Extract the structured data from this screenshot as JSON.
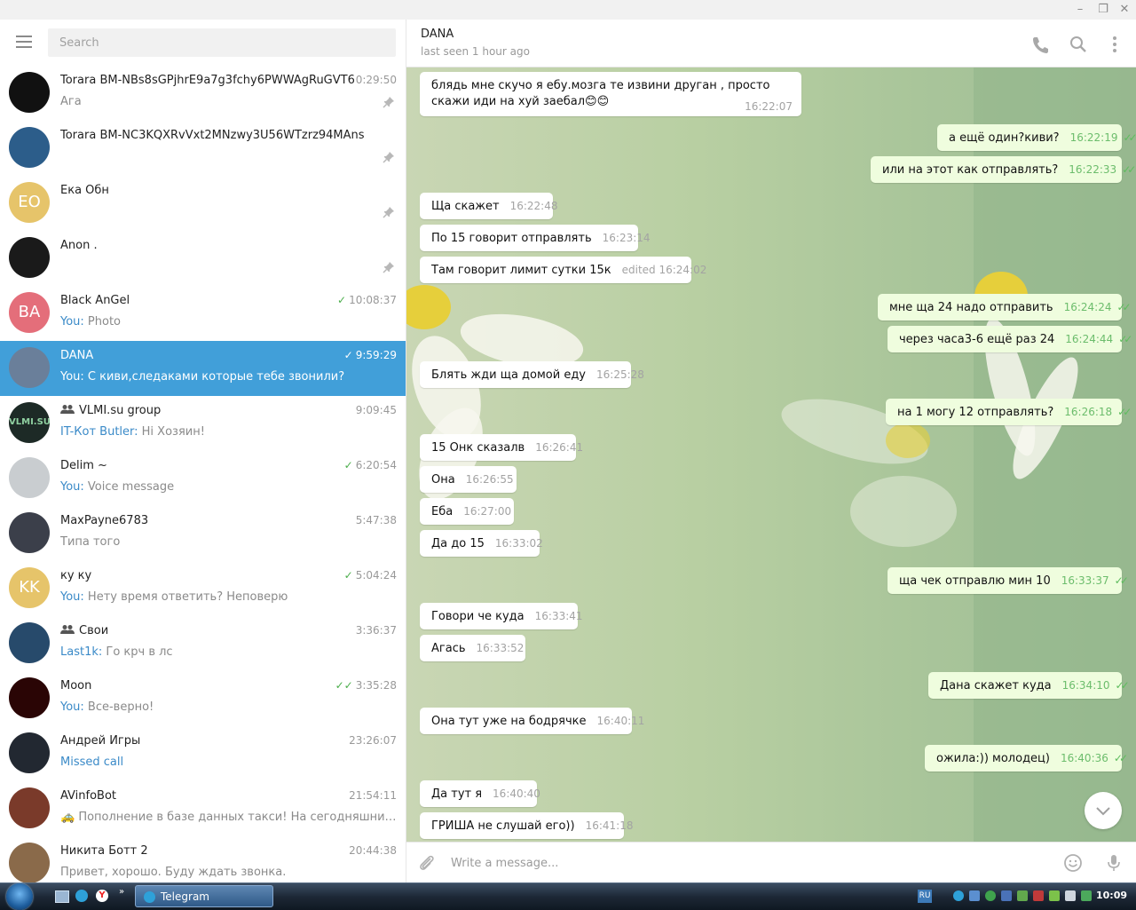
{
  "window": {
    "controls": [
      "–",
      "❐",
      "✕"
    ]
  },
  "sidebar": {
    "search_placeholder": "Search",
    "chats": [
      {
        "name": "Torara BM-NBs8sGPjhrE9a7g3fchy6PWWAgRuGVT6",
        "time": "0:29:50",
        "preview": "Ага",
        "pinned": true,
        "avatar_initials": "",
        "avatar_color": "#111111"
      },
      {
        "name": "Torara BM-NC3KQXRvVxt2MNzwy3U56WTzrz94MAns",
        "time": "",
        "preview": "",
        "pinned": true,
        "avatar_initials": "",
        "avatar_color": "#2c5d8a"
      },
      {
        "name": "Ека Обн",
        "time": "",
        "preview": "",
        "pinned": true,
        "avatar_initials": "EO",
        "avatar_color": "#e6c46a"
      },
      {
        "name": "Anon .",
        "time": "",
        "preview": "",
        "pinned": true,
        "avatar_initials": "",
        "avatar_color": "#1a1a1a"
      },
      {
        "name": "Black AnGel",
        "time": "10:08:37",
        "you": "You: ",
        "preview": "Photo",
        "check": "✓",
        "avatar_initials": "BA",
        "avatar_color": "#e46e7a"
      },
      {
        "name": "DANA",
        "time": "9:59:29",
        "you": "You: ",
        "preview": "С киви,следаками которые тебе звонили?",
        "check": "✓",
        "active": true,
        "avatar_initials": "",
        "avatar_color": "#6a7f9a"
      },
      {
        "name": "VLMI.su group",
        "time": "9:09:45",
        "you": "IT-Кот Butler: ",
        "preview": "Hi Хозяин!",
        "group": true,
        "avatar_initials": "VLMI.SU",
        "avatar_color": "#1d2a26"
      },
      {
        "name": "Delim ~",
        "time": "6:20:54",
        "you": "You: ",
        "preview": "Voice message",
        "check": "✓",
        "avatar_initials": "",
        "avatar_color": "#c9cdd0"
      },
      {
        "name": "MaxPayne6783",
        "time": "5:47:38",
        "preview": "Типа того",
        "avatar_initials": "",
        "avatar_color": "#3b3f4a"
      },
      {
        "name": "ку ку",
        "time": "5:04:24",
        "you": "You: ",
        "preview": "Нету время ответить? Неповерю",
        "check": "✓",
        "avatar_initials": "KK",
        "avatar_color": "#e6c46a"
      },
      {
        "name": "Свои",
        "time": "3:36:37",
        "you": "Last1k: ",
        "preview": "Го крч в лс",
        "group": true,
        "avatar_initials": "",
        "avatar_color": "#274a6b"
      },
      {
        "name": "Moon",
        "time": "3:35:28",
        "you": "You: ",
        "preview": "Все-верно!",
        "check": "✓✓",
        "avatar_initials": "",
        "avatar_color": "#2a0505"
      },
      {
        "name": "Андрей Игры",
        "time": "23:26:07",
        "you": "Missed call",
        "preview": "",
        "avatar_initials": "",
        "avatar_color": "#222831"
      },
      {
        "name": "AVinfoBot",
        "time": "21:54:11",
        "preview": "🚕 Пополнение в базе данных такси! На сегодняшний ден...",
        "avatar_initials": "",
        "avatar_color": "#7a3a2a"
      },
      {
        "name": "Никита Ботт 2",
        "time": "20:44:38",
        "preview": "Привет, хорошо.  Буду ждать звонка.",
        "avatar_initials": "",
        "avatar_color": "#8a6a4a"
      }
    ]
  },
  "chat": {
    "peer_name": "DANA",
    "peer_status": "last seen 1 hour ago",
    "messages": [
      {
        "dir": "in",
        "text": "блядь мне скучо я ебу.мозга те извини друган , просто скажи иди на хуй заебал😊😊",
        "time": "16:22:07"
      },
      {
        "dir": "out",
        "text": "а ещё один?киви?",
        "time": "16:22:19"
      },
      {
        "dir": "out",
        "text": "или на этот как отправлять?",
        "time": "16:22:33"
      },
      {
        "dir": "in",
        "text": "Ща скажет",
        "time": "16:22:48"
      },
      {
        "dir": "in",
        "text": "По 15 говорит отправлять",
        "time": "16:23:14"
      },
      {
        "dir": "in",
        "text": "Там говорит лимит сутки 15к",
        "time": "edited 16:24:02"
      },
      {
        "dir": "out",
        "text": "мне ща 24 надо отправить",
        "time": "16:24:24"
      },
      {
        "dir": "out",
        "text": "через часа3-6 ещё раз 24",
        "time": "16:24:44"
      },
      {
        "dir": "in",
        "text": "Блять жди ща домой еду",
        "time": "16:25:28"
      },
      {
        "dir": "out",
        "text": "на 1 могу 12 отправлять?",
        "time": "16:26:18"
      },
      {
        "dir": "in",
        "text": "15 Онк сказалв",
        "time": "16:26:41"
      },
      {
        "dir": "in",
        "text": "Она",
        "time": "16:26:55"
      },
      {
        "dir": "in",
        "text": "Еба",
        "time": "16:27:00"
      },
      {
        "dir": "in",
        "text": "Да до 15",
        "time": "16:33:02"
      },
      {
        "dir": "out",
        "text": "ща чек отправлю мин 10",
        "time": "16:33:37"
      },
      {
        "dir": "in",
        "text": "Говори че куда",
        "time": "16:33:41"
      },
      {
        "dir": "in",
        "text": "Агась",
        "time": "16:33:52"
      },
      {
        "dir": "out",
        "text": "Дана скажет куда",
        "time": "16:34:10"
      },
      {
        "dir": "in",
        "text": "Она тут уже на бодрячке",
        "time": "16:40:11"
      },
      {
        "dir": "out",
        "text": "ожила:)) молодец)",
        "time": "16:40:36"
      },
      {
        "dir": "in",
        "text": "Да тут я",
        "time": "16:40:40"
      },
      {
        "dir": "in",
        "text": "ГРИША не слушай его))",
        "time": "16:41:18"
      }
    ],
    "input_placeholder": "Write a message..."
  },
  "taskbar": {
    "task_label": "Telegram",
    "lang": "RU",
    "clock": "10:09"
  },
  "colors": {
    "accent": "#419fd9",
    "out_bubble": "#effdde",
    "read_tick": "#5ebc5e"
  }
}
